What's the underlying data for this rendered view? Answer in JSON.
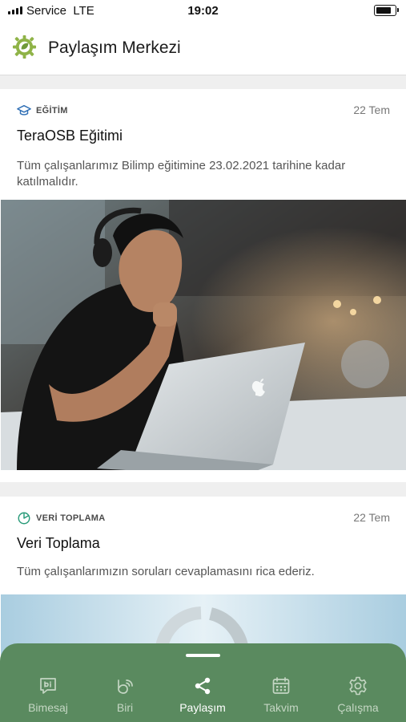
{
  "status_bar": {
    "carrier": "Service",
    "network": "LTE",
    "time": "19:02",
    "battery_level": 0.8
  },
  "header": {
    "title": "Paylaşım Merkezi",
    "logo_icon": "gear-leaf-logo"
  },
  "cards": [
    {
      "category": "EĞİTİM",
      "category_icon": "graduation-cap-icon",
      "date": "22 Tem",
      "title": "TeraOSB Eğitimi",
      "description": "Tüm çalışanlarımız Bilimp eğitimine 23.02.2021 tarihine kadar katılmalıdır.",
      "image": "man-with-headphones-using-laptop-photo"
    },
    {
      "category": "VERİ TOPLAMA",
      "category_icon": "pie-chart-icon",
      "date": "22 Tem",
      "title": "Veri Toplama",
      "description": "Tüm çalışanlarımızın soruları cevaplamasını rica ederiz.",
      "image": "donut-graphic-photo"
    }
  ],
  "nav": {
    "items": [
      {
        "label": "Bimesaj",
        "icon": "message-bubble-icon",
        "active": false
      },
      {
        "label": "Biri",
        "icon": "broadcast-icon",
        "active": false
      },
      {
        "label": "Paylaşım",
        "icon": "share-icon",
        "active": true
      },
      {
        "label": "Takvim",
        "icon": "calendar-icon",
        "active": false
      },
      {
        "label": "Çalışma",
        "icon": "gear-icon",
        "active": false
      }
    ]
  },
  "colors": {
    "nav_bg": "#5a8a5f",
    "accent_teal": "#2a9b7a",
    "category_blue": "#2f6fb5"
  }
}
